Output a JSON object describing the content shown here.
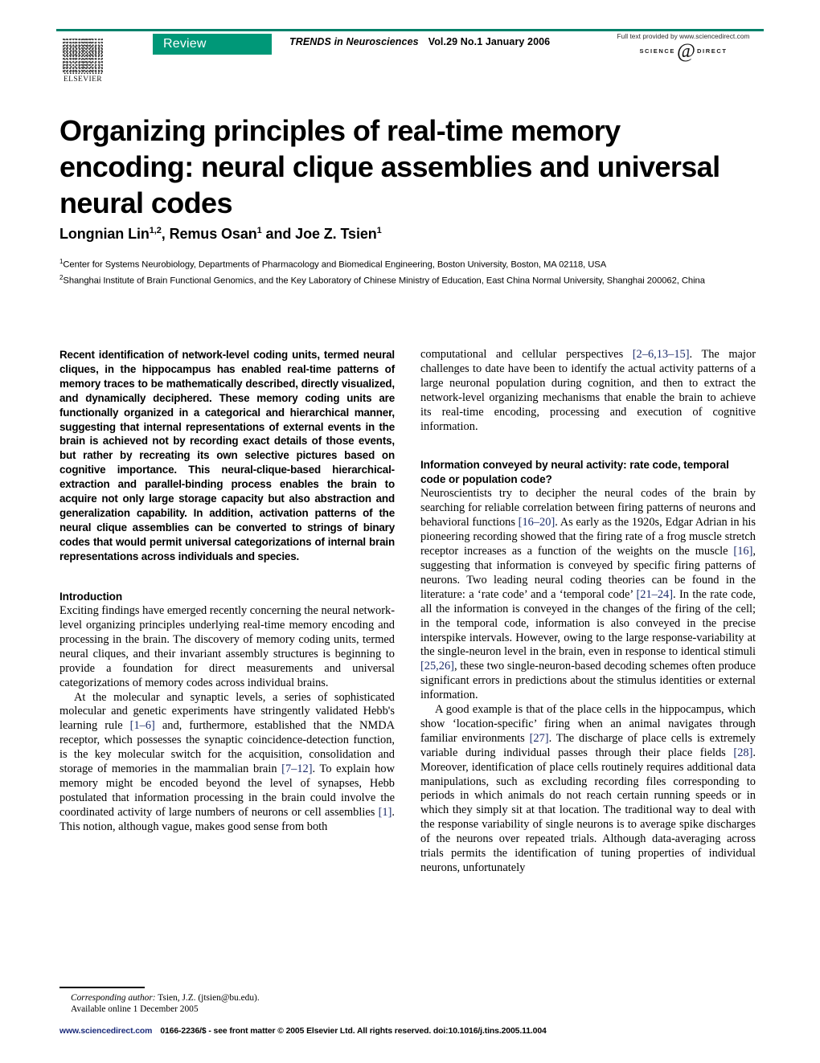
{
  "masthead": {
    "publisher_logo_text": "ELSEVIER",
    "article_type_badge": "Review",
    "journal_name": "TRENDS in Neurosciences",
    "volume_line": "Vol.29 No.1 January 2006",
    "sciencedirect_fulltext": "Full text provided by www.sciencedirect.com",
    "sciencedirect_logo_left": "SCIENCE",
    "sciencedirect_logo_at": "@",
    "sciencedirect_logo_right": "DIRECT",
    "accent_green": "#009878",
    "rule_green": "#00816a"
  },
  "article": {
    "title": "Organizing principles of real-time memory encoding: neural clique assemblies and universal neural codes",
    "authors_html": "Longnian Lin<sup>1,2</sup>, Remus Osan<sup>1</sup> and Joe Z. Tsien<sup>1</sup>",
    "affiliations_html": "<sup>1</sup>Center for Systems Neurobiology, Departments of Pharmacology and Biomedical Engineering, Boston University, Boston, MA 02118, USA<br><sup>2</sup>Shanghai Institute of Brain Functional Genomics, and the Key Laboratory of Chinese Ministry of Education, East China Normal University, Shanghai 200062, China"
  },
  "abstract": {
    "text": "Recent identification of network-level coding units, termed neural cliques, in the hippocampus has enabled real-time patterns of memory traces to be mathematically described, directly visualized, and dynamically deciphered. These memory coding units are functionally organized in a categorical and hierarchical manner, suggesting that internal representations of external events in the brain is achieved not by recording exact details of those events, but rather by recreating its own selective pictures based on cognitive importance. This neural-clique-based hierarchical-extraction and parallel-binding process enables the brain to acquire not only large storage capacity but also abstraction and generalization capability. In addition, activation patterns of the neural clique assemblies can be converted to strings of binary codes that would permit universal categorizations of internal brain representations across individuals and species."
  },
  "sections": {
    "introduction": {
      "heading": "Introduction",
      "para1_a": "Exciting findings have emerged recently concerning the neural network-level organizing principles underlying real-time memory encoding and processing in the brain. The discovery of memory coding units, termed neural cliques, and their invariant assembly structures is beginning to provide a foundation for direct measurements and universal categorizations of memory codes across individual brains.",
      "para2_a": "At the molecular and synaptic levels, a series of sophisticated molecular and genetic experiments have stringently validated Hebb's learning rule ",
      "para2_ref1": "[1–6]",
      "para2_b": " and, furthermore, established that the NMDA receptor, which possesses the synaptic coincidence-detection function, is the key molecular switch for the acquisition, consolidation and storage of memories in the mammalian brain ",
      "para2_ref2": "[7–12]",
      "para2_c": ". To explain how memory might be encoded beyond the level of synapses, Hebb postulated that information processing in the brain could involve the coordinated activity of large numbers of neurons or cell assemblies ",
      "para2_ref3": "[1]",
      "para2_d": ". This notion, although vague, makes good sense from both ",
      "para2_cont_a": "computational and cellular perspectives ",
      "para2_cont_ref": "[2–6,13–15]",
      "para2_cont_b": ". The major challenges to date have been to identify the actual activity patterns of a large neuronal population during cognition, and then to extract the network-level organizing mechanisms that enable the brain to achieve its real-time encoding, processing and execution of cognitive information."
    },
    "rate_code": {
      "heading": "Information conveyed by neural activity: rate code, temporal code or population code?",
      "para1_a": "Neuroscientists try to decipher the neural codes of the brain by searching for reliable correlation between firing patterns of neurons and behavioral functions ",
      "para1_ref1": "[16–20]",
      "para1_b": ". As early as the 1920s, Edgar Adrian in his pioneering recording showed that the firing rate of a frog muscle stretch receptor increases as a function of the weights on the muscle ",
      "para1_ref2": "[16]",
      "para1_c": ", suggesting that information is conveyed by specific firing patterns of neurons. Two leading neural coding theories can be found in the literature: a ‘rate code’ and a ‘temporal code’ ",
      "para1_ref3": "[21–24]",
      "para1_d": ". In the rate code, all the information is conveyed in the changes of the firing of the cell; in the temporal code, information is also conveyed in the precise interspike intervals. However, owing to the large response-variability at the single-neuron level in the brain, even in response to identical stimuli ",
      "para1_ref4": "[25,26]",
      "para1_e": ", these two single-neuron-based decoding schemes often produce significant errors in predictions about the stimulus identities or external information.",
      "para2_a": "A good example is that of the place cells in the hippocampus, which show ‘location-specific’ firing when an animal navigates through familiar environments ",
      "para2_ref1": "[27]",
      "para2_b": ". The discharge of place cells is extremely variable during individual passes through their place fields ",
      "para2_ref2": "[28]",
      "para2_c": ". Moreover, identification of place cells routinely requires additional data manipulations, such as excluding recording files corresponding to periods in which animals do not reach certain running speeds or in which they simply sit at that location. The traditional way to deal with the response variability of single neurons is to average spike discharges of the neurons over repeated trials. Although data-averaging across trials permits the identification of tuning properties of individual neurons, unfortunately"
    }
  },
  "footnote": {
    "corresponding_label": "Corresponding author:",
    "corresponding_value": " Tsien, J.Z. (jtsien@bu.edu).",
    "available_online": "Available online 1 December 2005"
  },
  "bottom_bar": {
    "sciencedirect_url": "www.sciencedirect.com",
    "copyright": "0166-2236/$ - see front matter © 2005 Elsevier Ltd. All rights reserved. doi:10.1016/j.tins.2005.11.004"
  }
}
